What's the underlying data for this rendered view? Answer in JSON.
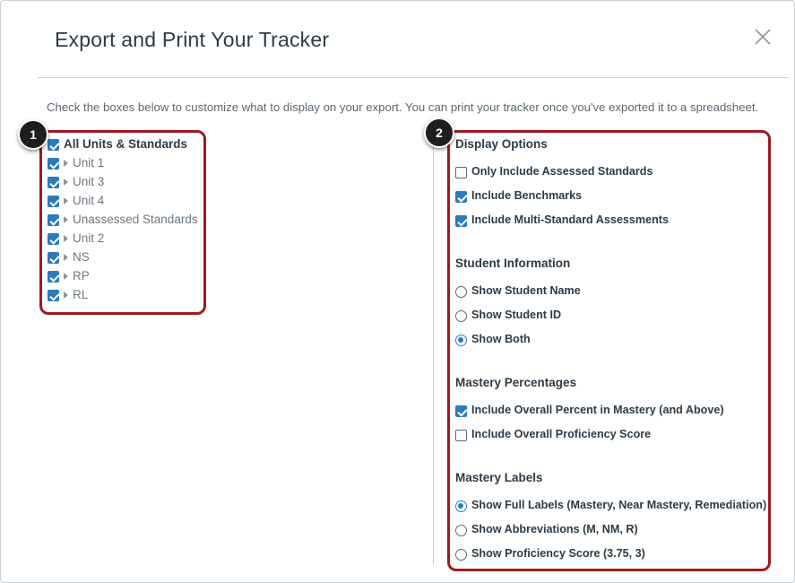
{
  "dialog": {
    "title": "Export and Print Your Tracker",
    "instructions": "Check the boxes below to customize what to display on your export. You can print your tracker once you've exported it to a spreadsheet."
  },
  "badges": {
    "one": "1",
    "two": "2"
  },
  "units": {
    "root": {
      "label": "All Units & Standards",
      "checked": true
    },
    "items": [
      {
        "label": "Unit 1",
        "checked": true
      },
      {
        "label": "Unit 3",
        "checked": true
      },
      {
        "label": "Unit 4",
        "checked": true
      },
      {
        "label": "Unassessed Standards",
        "checked": true
      },
      {
        "label": "Unit 2",
        "checked": true
      },
      {
        "label": "NS",
        "checked": true
      },
      {
        "label": "RP",
        "checked": true
      },
      {
        "label": "RL",
        "checked": true
      }
    ]
  },
  "display_options": {
    "heading": "Display Options",
    "items": [
      {
        "label": "Only Include Assessed Standards",
        "checked": false
      },
      {
        "label": "Include Benchmarks",
        "checked": true
      },
      {
        "label": "Include Multi-Standard Assessments",
        "checked": true
      }
    ]
  },
  "student_information": {
    "heading": "Student Information",
    "items": [
      {
        "label": "Show Student Name",
        "selected": false
      },
      {
        "label": "Show Student ID",
        "selected": false
      },
      {
        "label": "Show Both",
        "selected": true
      }
    ]
  },
  "mastery_percentages": {
    "heading": "Mastery Percentages",
    "items": [
      {
        "label": "Include Overall Percent in Mastery (and Above)",
        "checked": true
      },
      {
        "label": "Include Overall Proficiency Score",
        "checked": false
      }
    ]
  },
  "mastery_labels": {
    "heading": "Mastery Labels",
    "items": [
      {
        "label": "Show Full Labels (Mastery, Near Mastery, Remediation)",
        "selected": true
      },
      {
        "label": "Show Abbreviations (M, NM, R)",
        "selected": false
      },
      {
        "label": "Show Proficiency Score (3.75, 3)",
        "selected": false
      }
    ]
  },
  "colors": {
    "accent": "#2b7abc",
    "highlight": "#9b1b22",
    "text": "#2d3b45"
  },
  "icons": {
    "close": "close-icon",
    "expand": "caret-right-icon"
  }
}
